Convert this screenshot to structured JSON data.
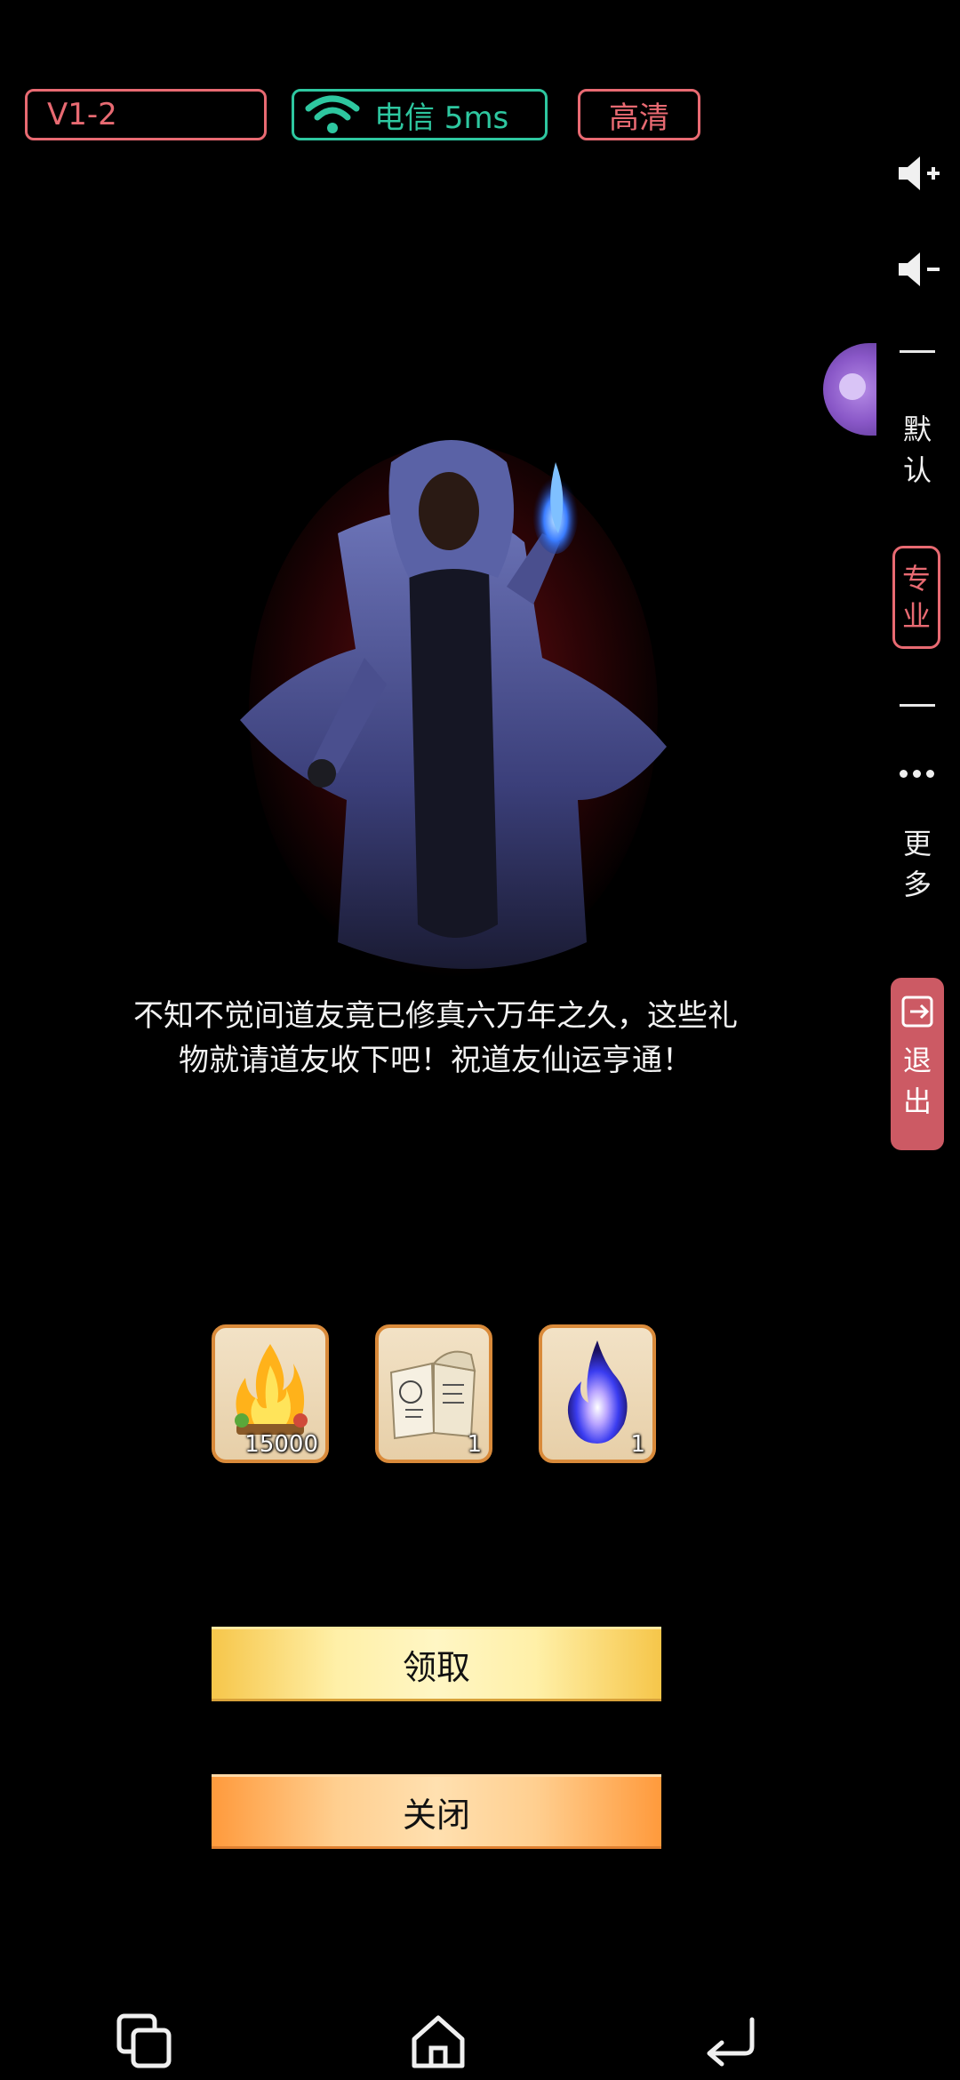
{
  "status_bar": {
    "version": "V1-2",
    "network": "电信 5ms",
    "quality": "高清"
  },
  "sidebar": {
    "volume_up_icon": "volume-up-icon",
    "volume_down_icon": "volume-down-icon",
    "default_label": [
      "默",
      "认"
    ],
    "pro_label": [
      "专",
      "业"
    ],
    "more_label": [
      "更",
      "多"
    ],
    "exit_label": [
      "退",
      "出"
    ]
  },
  "dialog": {
    "message_line1": "不知不觉间道友竟已修真六万年之久，这些礼",
    "message_line2": "物就请道友收下吧！祝道友仙运亨通！",
    "rewards": [
      {
        "icon": "golden-flame-icon",
        "count": "15000"
      },
      {
        "icon": "book-icon",
        "count": "1"
      },
      {
        "icon": "blue-spirit-flame-icon",
        "count": "1"
      }
    ],
    "claim_label": "领取",
    "close_label": "关闭"
  },
  "colors": {
    "accent_red": "#e86a72",
    "accent_teal": "#2ec7a0",
    "exit_bg": "#cc5a64"
  }
}
